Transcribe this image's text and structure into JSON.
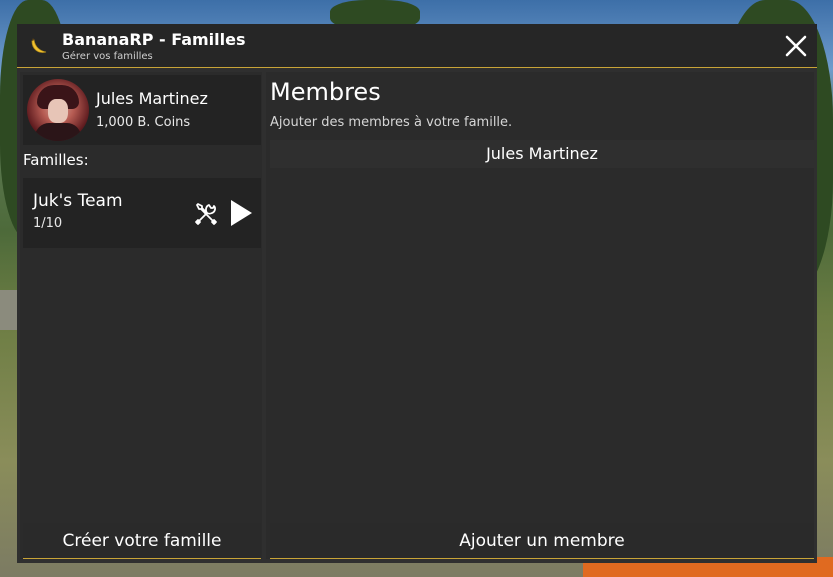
{
  "window": {
    "title": "BananaRP - Familles",
    "subtitle": "Gérer vos familles",
    "accent_color": "#c9a437",
    "icon": "banana-icon",
    "close_icon": "close-icon"
  },
  "sidebar": {
    "profile": {
      "name": "Jules Martinez",
      "coins": "1,000 B. Coins"
    },
    "families_label": "Familles:",
    "families": [
      {
        "name": "Juk's Team",
        "count": "1/10",
        "manage_icon": "tools-icon",
        "open_icon": "play-icon"
      }
    ],
    "create_button": "Créer votre famille"
  },
  "main": {
    "title": "Membres",
    "subtitle": "Ajouter des membres à votre famille.",
    "members": [
      "Jules Martinez"
    ],
    "add_button": "Ajouter un membre"
  }
}
